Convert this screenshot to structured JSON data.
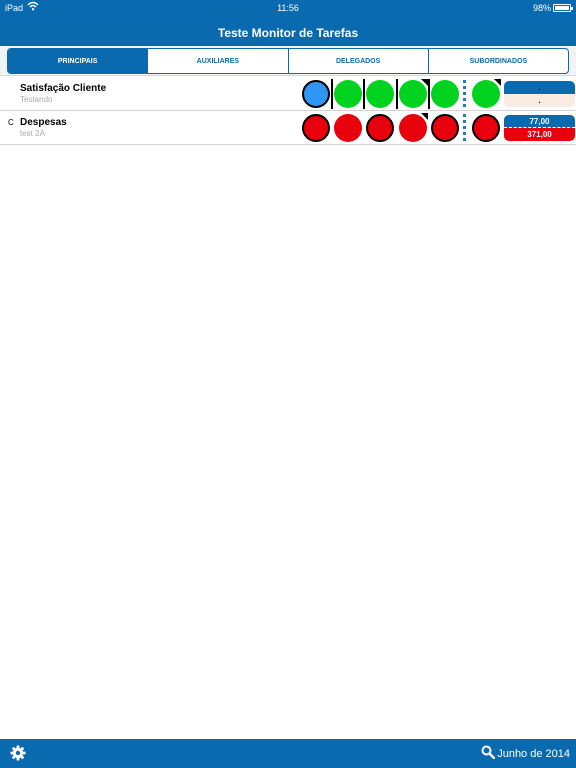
{
  "status_bar": {
    "carrier": "iPad",
    "time": "11:56",
    "battery": "98%",
    "battery_level": 0.98
  },
  "nav": {
    "title": "Teste Monitor de Tarefas"
  },
  "tabs": [
    {
      "label": "PRINCIPAIS",
      "active": true
    },
    {
      "label": "AUXILIARES",
      "active": false
    },
    {
      "label": "DELEGADOS",
      "active": false
    },
    {
      "label": "SUBORDINADOS",
      "active": false
    }
  ],
  "rows": [
    {
      "prefix": "",
      "title": "Satisfação Cliente",
      "subtitle": "Testando",
      "status_colors": [
        "blue",
        "green",
        "green",
        "green",
        "green",
        "green"
      ],
      "value_top": ".",
      "value_bottom": "."
    },
    {
      "prefix": "C",
      "title": "Despesas",
      "subtitle": "test 2A",
      "status_colors": [
        "red",
        "red",
        "red",
        "red",
        "red",
        "red"
      ],
      "value_top": "77,00",
      "value_bottom": "371,00"
    }
  ],
  "colors": {
    "brand": "#0a6ab0",
    "status_blue": "#2f96f5",
    "status_green": "#00d21f",
    "status_red": "#e8000c",
    "value_box_beige": "#f8ece2",
    "value_box_red": "#e8000c"
  },
  "footer": {
    "settings_icon": "gear-icon",
    "search_icon": "search-icon",
    "period_label": "Junho de 2014"
  }
}
